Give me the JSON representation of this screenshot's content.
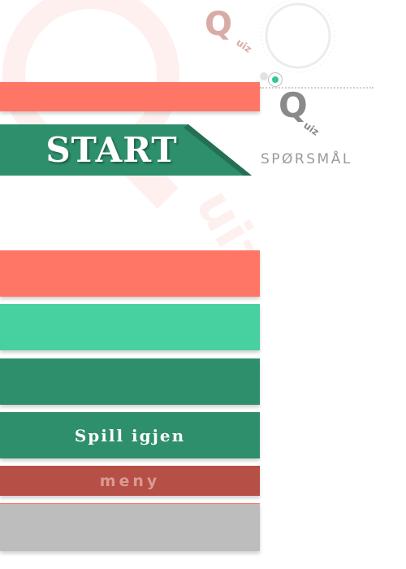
{
  "logo": {
    "letter": "Q",
    "word": "uiz"
  },
  "header": {
    "question_label": "SPØRSMÅL"
  },
  "start": {
    "label": "START"
  },
  "answers": [
    {
      "label": ""
    },
    {
      "label": ""
    },
    {
      "label": ""
    }
  ],
  "actions": {
    "replay_label": "Spill igjen",
    "menu_label": "meny"
  },
  "progress": {
    "current_step": 2
  },
  "colors": {
    "coral": "#ff7566",
    "mint": "#47d0a0",
    "dark_green": "#2e8f6c",
    "brick": "#b64f45",
    "gray": "#bdbdbd",
    "progress_active": "#2ec99a"
  }
}
